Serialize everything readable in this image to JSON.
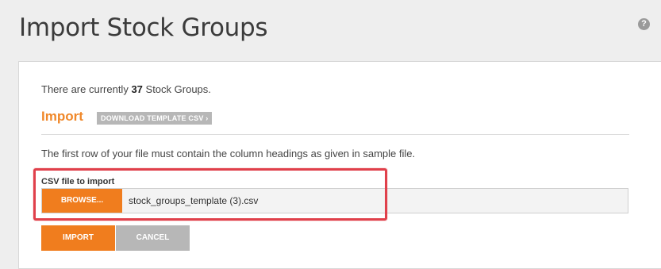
{
  "header": {
    "title": "Import Stock Groups",
    "help_glyph": "?"
  },
  "panel": {
    "count_prefix": "There are currently ",
    "count_value": "37",
    "count_suffix": " Stock Groups.",
    "import_heading": "Import",
    "template_button_label": "DOWNLOAD TEMPLATE CSV ›",
    "instructions": "The first row of your file must contain the column headings as given in sample file."
  },
  "file_input": {
    "label": "CSV file to import",
    "browse_label": "BROWSE...",
    "file_name": "stock_groups_template (3).csv"
  },
  "actions": {
    "import_label": "IMPORT",
    "cancel_label": "CANCEL"
  },
  "colors": {
    "accent": "#f07d1e",
    "heading_accent": "#f0882a",
    "muted_button": "#b7b7b7",
    "highlight": "#e0404b"
  },
  "icons": {
    "help": "help-icon"
  }
}
